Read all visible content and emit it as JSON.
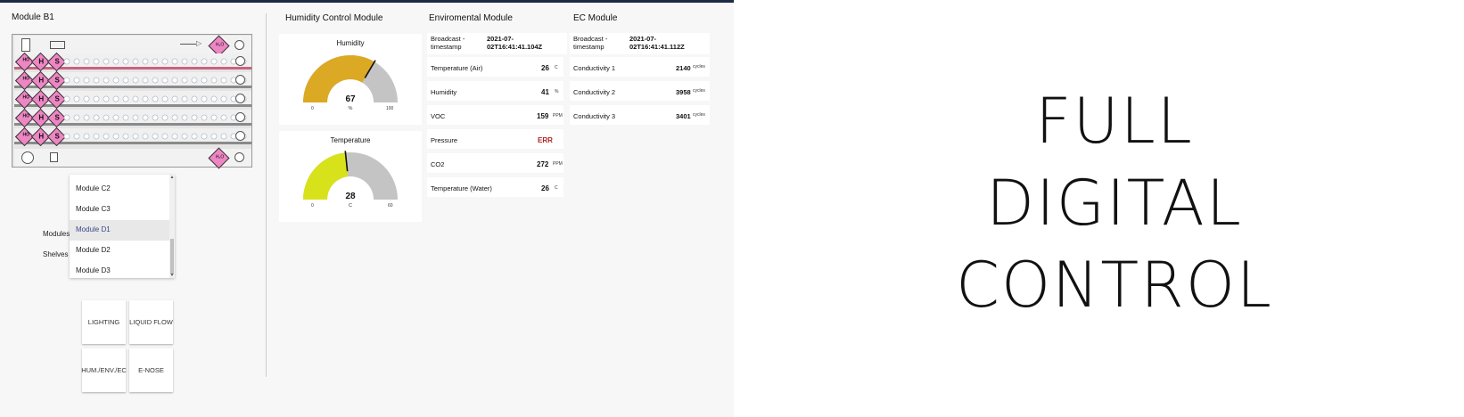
{
  "module_b1": {
    "title": "Module B1",
    "pump_label": "H₂O",
    "rows": [
      {
        "badges": [
          "HO",
          "H",
          "S"
        ]
      },
      {
        "badges": [
          "HO",
          "H",
          "S"
        ]
      },
      {
        "badges": [
          "HO",
          "H",
          "S"
        ]
      },
      {
        "badges": [
          "HO",
          "H",
          "S"
        ]
      },
      {
        "badges": [
          "HO",
          "H",
          "S"
        ]
      }
    ]
  },
  "selector": {
    "modules_label": "Modules",
    "shelves_label": "Shelves",
    "options": [
      "Module C2",
      "Module C3",
      "Module D1",
      "Module D2",
      "Module D3"
    ],
    "selected": "Module D1",
    "scroll_up_icon": "triangle-up",
    "scroll_down_icon": "triangle-down"
  },
  "buttons": {
    "lighting": "LIGHTING",
    "liquid_flow": "LIQUID FLOW",
    "hum_env_ec": "HUM./ENV./EC",
    "e_nose": "E-NOSE"
  },
  "humidity_module": {
    "title": "Humidity Control Module",
    "gauges": [
      {
        "title": "Humidity",
        "value": 67,
        "unit": "%",
        "min": 0,
        "max": 100,
        "fill_color": "#dba923"
      },
      {
        "title": "Temperature",
        "value": 28,
        "unit": "C",
        "min": 0,
        "max": 60,
        "fill_color": "#d8e21a"
      }
    ]
  },
  "environmental_module": {
    "title": "Enviromental Module",
    "broadcast_label_1": "Broadcast -",
    "broadcast_label_2": "timestamp",
    "broadcast_value_1": "2021-07-",
    "broadcast_value_2": "02T16:41:41.104Z",
    "rows": [
      {
        "label": "Temperature (Air)",
        "value": "26",
        "unit": "C"
      },
      {
        "label": "Humidity",
        "value": "41",
        "unit": "%"
      },
      {
        "label": "VOC",
        "value": "159",
        "unit": "PPM"
      },
      {
        "label": "Pressure",
        "value": "ERR",
        "unit": ""
      },
      {
        "label": "CO2",
        "value": "272",
        "unit": "PPM"
      },
      {
        "label": "Temperature (Water)",
        "value": "26",
        "unit": "C"
      }
    ]
  },
  "ec_module": {
    "title": "EC Module",
    "broadcast_label_1": "Broadcast -",
    "broadcast_label_2": "timestamp",
    "broadcast_value_1": "2021-07-",
    "broadcast_value_2": "02T16:41:41.112Z",
    "rows": [
      {
        "label": "Conductivity 1",
        "value": "2140",
        "unit": "cycles"
      },
      {
        "label": "Conductivity 2",
        "value": "3958",
        "unit": "cycles"
      },
      {
        "label": "Conductivity 3",
        "value": "3401",
        "unit": "cycles"
      }
    ]
  },
  "headline": {
    "line1": "FULL",
    "line2": "DIGITAL",
    "line3": "CONTROL"
  },
  "colors": {
    "gauge_track": "#c4c4c4",
    "error": "#b22222",
    "accent_navy": "#1d2a44",
    "pump_pink": "#ee86c4"
  }
}
